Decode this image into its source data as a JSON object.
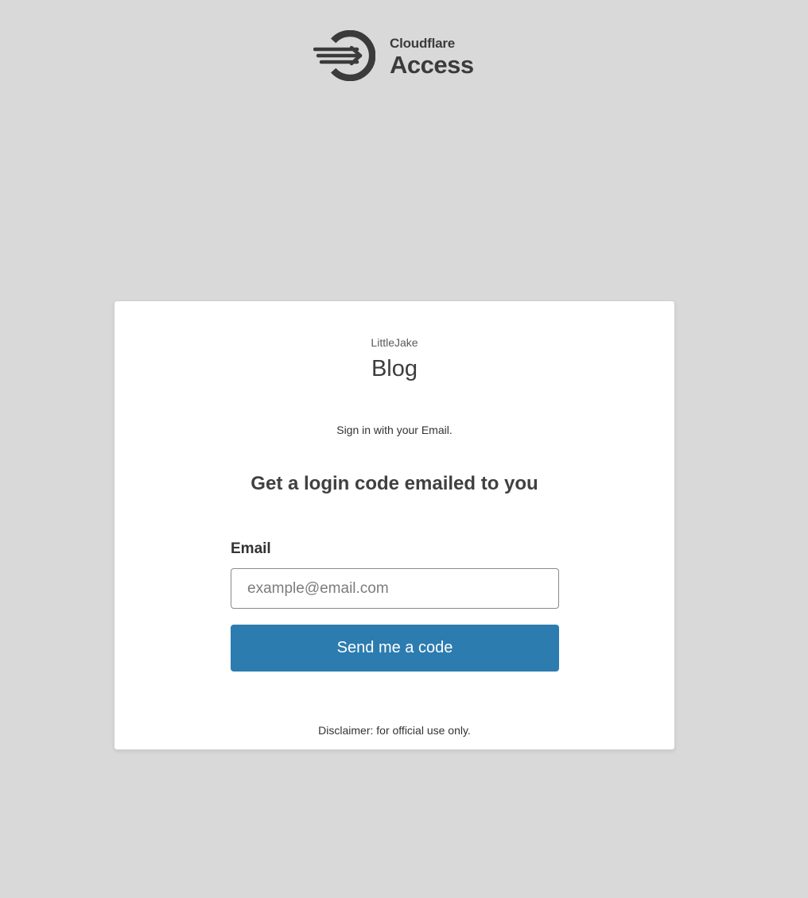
{
  "logo": {
    "brand": "Cloudflare",
    "product": "Access",
    "icon": "cloudflare-access-logo-icon"
  },
  "card": {
    "org_name": "LittleJake",
    "app_name": "Blog",
    "sign_in_text": "Sign in with your Email.",
    "form_heading": "Get a login code emailed to you",
    "email_label": "Email",
    "email_placeholder": "example@email.com",
    "email_value": "",
    "send_button_label": "Send me a code",
    "disclaimer": "Disclaimer: for official use only."
  },
  "colors": {
    "background": "#d9d9d9",
    "card": "#ffffff",
    "button": "#2c7cb0",
    "logo": "#3b3b3b"
  }
}
